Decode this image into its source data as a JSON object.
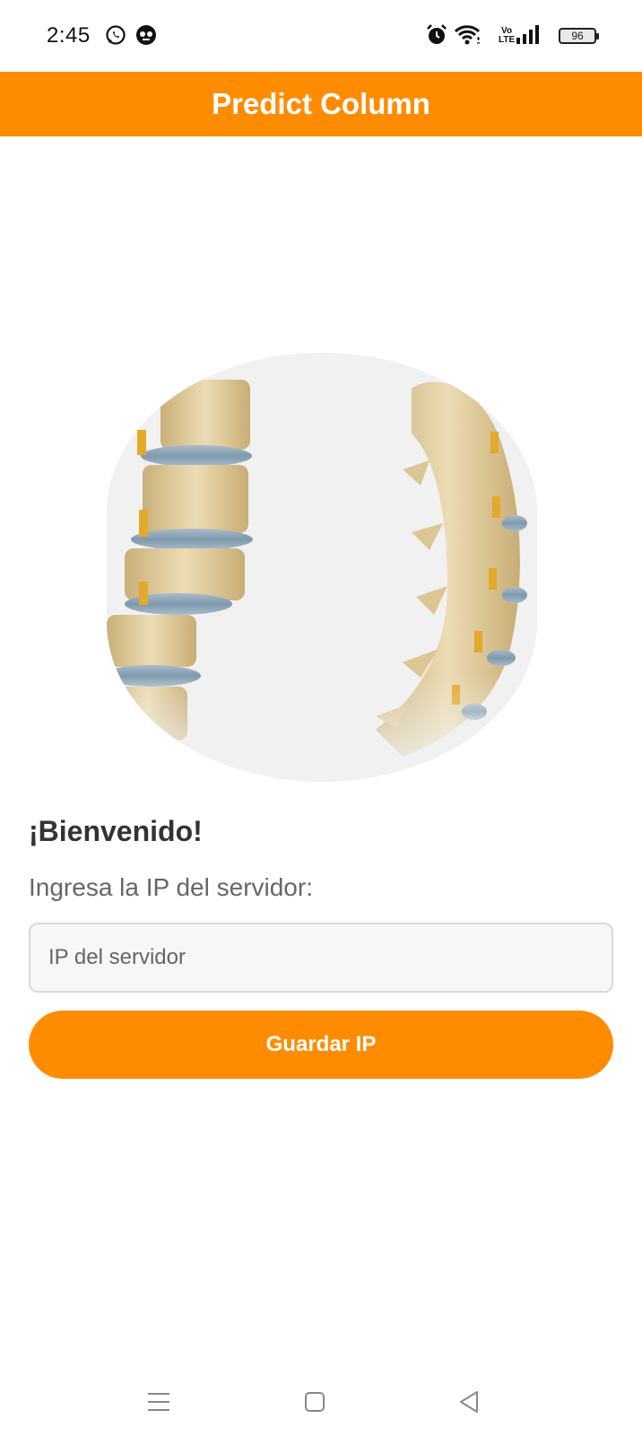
{
  "status_bar": {
    "time": "2:45",
    "battery": "96",
    "network": "VoLTE",
    "icons": [
      "whatsapp-icon",
      "notification-app-icon",
      "alarm-icon",
      "wifi-icon",
      "volte-icon",
      "signal-icon",
      "battery-icon"
    ]
  },
  "app_bar": {
    "title": "Predict Column"
  },
  "hero": {
    "subject": "spine-illustration-icon"
  },
  "main": {
    "welcome": "¡Bienvenido!",
    "prompt": "Ingresa la IP del servidor:",
    "ip_input": {
      "placeholder": "IP del servidor",
      "value": ""
    },
    "save_button": "Guardar IP"
  },
  "nav_bar": {
    "buttons": [
      "recents-icon",
      "home-icon",
      "back-icon"
    ]
  },
  "colors": {
    "accent": "#ff8c00",
    "background": "#ffffff",
    "input_bg": "#f7f7f7"
  }
}
